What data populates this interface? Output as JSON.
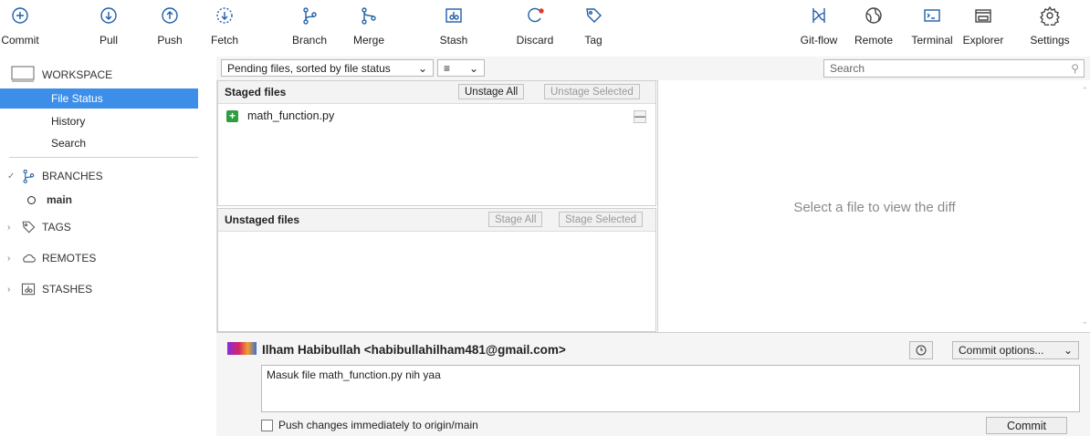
{
  "toolbar": {
    "left": [
      {
        "label": "Commit",
        "icon": "plus-circle-icon"
      },
      {
        "label": "Pull",
        "icon": "arrow-down-circle-icon"
      },
      {
        "label": "Push",
        "icon": "arrow-up-circle-icon"
      },
      {
        "label": "Fetch",
        "icon": "fetch-icon"
      },
      {
        "label": "Branch",
        "icon": "branch-icon"
      },
      {
        "label": "Merge",
        "icon": "merge-icon"
      },
      {
        "label": "Stash",
        "icon": "stash-icon"
      },
      {
        "label": "Discard",
        "icon": "discard-icon"
      },
      {
        "label": "Tag",
        "icon": "tag-icon"
      }
    ],
    "right": [
      {
        "label": "Git-flow",
        "icon": "git-flow-icon"
      },
      {
        "label": "Remote",
        "icon": "globe-icon"
      },
      {
        "label": "Terminal",
        "icon": "terminal-icon"
      },
      {
        "label": "Explorer",
        "icon": "folder-icon"
      },
      {
        "label": "Settings",
        "icon": "gear-icon"
      }
    ]
  },
  "sidebar": {
    "workspace": "WORKSPACE",
    "workspace_items": [
      "File Status",
      "History",
      "Search"
    ],
    "branches": "BRANCHES",
    "current_branch": "main",
    "tags": "TAGS",
    "remotes": "REMOTES",
    "stashes": "STASHES"
  },
  "filter": {
    "sort_label": "Pending files, sorted by file status",
    "view_icon": "list-view-icon",
    "search_placeholder": "Search"
  },
  "staged": {
    "title": "Staged files",
    "unstage_all": "Unstage All",
    "unstage_selected": "Unstage Selected",
    "files": [
      "math_function.py"
    ]
  },
  "unstaged": {
    "title": "Unstaged files",
    "stage_all": "Stage All",
    "stage_selected": "Stage Selected"
  },
  "diff": {
    "placeholder": "Select a file to view the diff"
  },
  "commit": {
    "author": "Ilham Habibullah <habibullahilham481@gmail.com>",
    "message": "Masuk file math_function.py nih yaa",
    "options_label": "Commit options...",
    "push_label": "Push changes immediately to origin/main",
    "commit_label": "Commit"
  },
  "colors": {
    "accent": "#3d8ee8",
    "icon": "#1f5fa8",
    "staged_badge": "#2e9e3e"
  }
}
